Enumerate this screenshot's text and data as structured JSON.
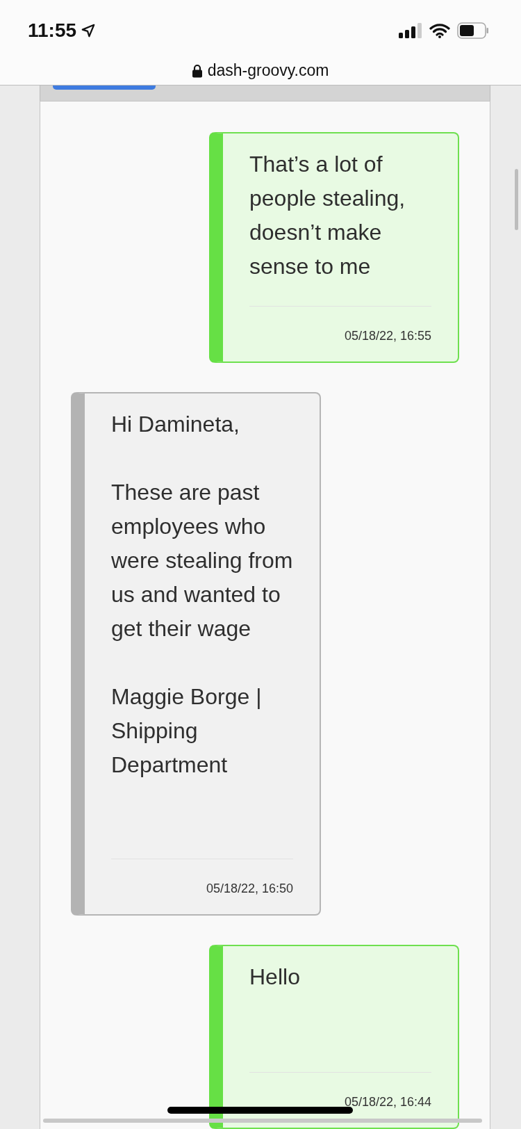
{
  "status_bar": {
    "time": "11:55"
  },
  "address_bar": {
    "url": "dash-groovy.com"
  },
  "messages": [
    {
      "kind": "sent",
      "paragraphs": [
        "That’s a lot of people stealing, doesn’t make sense to me"
      ],
      "time": "05/18/22, 16:55"
    },
    {
      "kind": "received",
      "paragraphs": [
        "Hi Damineta,",
        "These are past employees who were stealing from us and wanted to get their wage",
        "Maggie Borge | Shipping Department"
      ],
      "time": "05/18/22, 16:50"
    },
    {
      "kind": "sent",
      "paragraphs": [
        "Hello"
      ],
      "time": "05/18/22, 16:44"
    }
  ]
}
